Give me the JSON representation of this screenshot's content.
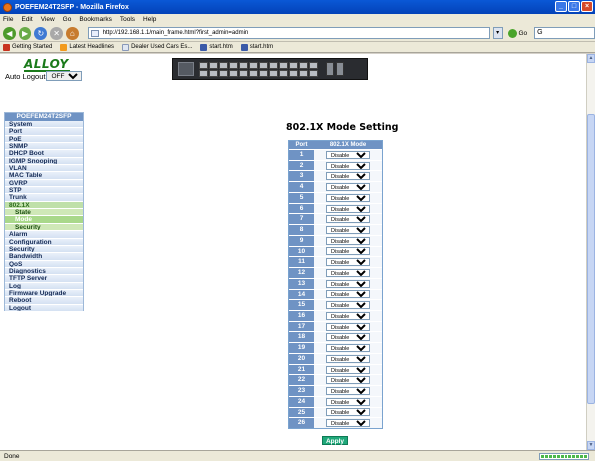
{
  "browser": {
    "window_title": "POEFEM24T2SFP - Mozilla Firefox",
    "menu": [
      "File",
      "Edit",
      "View",
      "Go",
      "Bookmarks",
      "Tools",
      "Help"
    ],
    "url": "http://192.168.1.1/main_frame.html?first_admin=admin",
    "go_label": "Go",
    "search_text": "G",
    "bookmarks": [
      {
        "label": "Getting Started",
        "icon": "bookmark-icon"
      },
      {
        "label": "Latest Headlines",
        "icon": "rss-icon"
      },
      {
        "label": "Dealer Used Cars Es...",
        "icon": "page-icon"
      },
      {
        "label": "start.htm",
        "icon": "page-icon"
      },
      {
        "label": "start.htm",
        "icon": "page-icon"
      }
    ],
    "status_text": "Done"
  },
  "banner": {
    "logo_text": "ALLOY",
    "auto_logout_label": "Auto Logout",
    "auto_logout_value": "OFF"
  },
  "sidebar": {
    "title": "POEFEM24T2SFP",
    "items": [
      {
        "label": "System",
        "state": "normal"
      },
      {
        "label": "Port",
        "state": "normal"
      },
      {
        "label": "PoE",
        "state": "normal"
      },
      {
        "label": "SNMP",
        "state": "normal"
      },
      {
        "label": "DHCP Boot",
        "state": "normal"
      },
      {
        "label": "IGMP Snooping",
        "state": "normal"
      },
      {
        "label": "VLAN",
        "state": "normal"
      },
      {
        "label": "MAC Table",
        "state": "normal"
      },
      {
        "label": "GVRP",
        "state": "normal"
      },
      {
        "label": "STP",
        "state": "normal"
      },
      {
        "label": "Trunk",
        "state": "normal"
      },
      {
        "label": "802.1X",
        "state": "active"
      },
      {
        "label": "State",
        "state": "sub"
      },
      {
        "label": "Mode",
        "state": "current"
      },
      {
        "label": "Security",
        "state": "sub"
      },
      {
        "label": "Alarm",
        "state": "normal"
      },
      {
        "label": "Configuration",
        "state": "normal"
      },
      {
        "label": "Security",
        "state": "normal"
      },
      {
        "label": "Bandwidth",
        "state": "normal"
      },
      {
        "label": "QoS",
        "state": "normal"
      },
      {
        "label": "Diagnostics",
        "state": "normal"
      },
      {
        "label": "TFTP Server",
        "state": "normal"
      },
      {
        "label": "Log",
        "state": "normal"
      },
      {
        "label": "Firmware Upgrade",
        "state": "normal"
      },
      {
        "label": "Reboot",
        "state": "normal"
      },
      {
        "label": "Logout",
        "state": "normal"
      }
    ]
  },
  "main": {
    "title": "802.1X Mode Setting",
    "col_port": "Port",
    "col_mode": "802.1X Mode",
    "rows": [
      {
        "port": "1",
        "mode": "Disable"
      },
      {
        "port": "2",
        "mode": "Disable"
      },
      {
        "port": "3",
        "mode": "Disable"
      },
      {
        "port": "4",
        "mode": "Disable"
      },
      {
        "port": "5",
        "mode": "Disable"
      },
      {
        "port": "6",
        "mode": "Disable"
      },
      {
        "port": "7",
        "mode": "Disable"
      },
      {
        "port": "8",
        "mode": "Disable"
      },
      {
        "port": "9",
        "mode": "Disable"
      },
      {
        "port": "10",
        "mode": "Disable"
      },
      {
        "port": "11",
        "mode": "Disable"
      },
      {
        "port": "12",
        "mode": "Disable"
      },
      {
        "port": "13",
        "mode": "Disable"
      },
      {
        "port": "14",
        "mode": "Disable"
      },
      {
        "port": "15",
        "mode": "Disable"
      },
      {
        "port": "16",
        "mode": "Disable"
      },
      {
        "port": "17",
        "mode": "Disable"
      },
      {
        "port": "18",
        "mode": "Disable"
      },
      {
        "port": "19",
        "mode": "Disable"
      },
      {
        "port": "20",
        "mode": "Disable"
      },
      {
        "port": "21",
        "mode": "Disable"
      },
      {
        "port": "22",
        "mode": "Disable"
      },
      {
        "port": "23",
        "mode": "Disable"
      },
      {
        "port": "24",
        "mode": "Disable"
      },
      {
        "port": "25",
        "mode": "Disable"
      },
      {
        "port": "26",
        "mode": "Disable"
      }
    ],
    "apply_label": "Apply"
  },
  "colors": {
    "header_blue": "#6f93c4",
    "menu_active_green": "#a9d88a",
    "apply_green": "#1fa87a",
    "logo_green": "#1a7a1a"
  }
}
